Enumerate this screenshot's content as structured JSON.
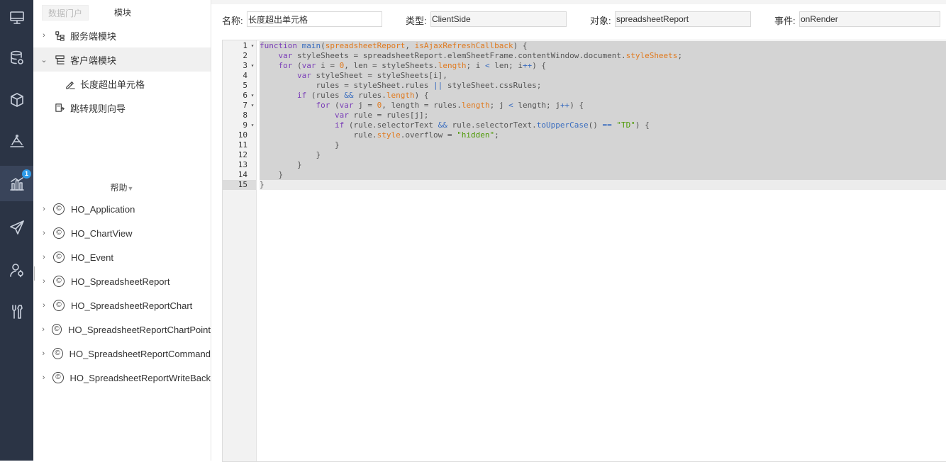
{
  "rail": {
    "items": [
      {
        "name": "monitor-icon"
      },
      {
        "name": "database-icon"
      },
      {
        "name": "cube-icon"
      },
      {
        "name": "layers-icon"
      },
      {
        "name": "chart-icon",
        "active": true,
        "badge": "1"
      },
      {
        "name": "send-icon"
      },
      {
        "name": "user-settings-icon"
      },
      {
        "name": "tools-icon"
      }
    ]
  },
  "panel": {
    "tabs": [
      "数据门户",
      "模块"
    ],
    "tree": [
      {
        "label": "服务端模块",
        "arrow": "›"
      },
      {
        "label": "客户端模块",
        "arrow": "⌄",
        "selected": true
      },
      {
        "label": "长度超出单元格",
        "child": true
      },
      {
        "label": "跳转规则向导"
      }
    ],
    "help_label": "帮助",
    "help_caret": "▼",
    "classes": [
      "HO_Application",
      "HO_ChartView",
      "HO_Event",
      "HO_SpreadsheetReport",
      "HO_SpreadsheetReportChart",
      "HO_SpreadsheetReportChartPoint",
      "HO_SpreadsheetReportCommand",
      "HO_SpreadsheetReportWriteBack"
    ],
    "class_icon": "©"
  },
  "fields": {
    "name_label": "名称:",
    "name_value": "长度超出单元格",
    "type_label": "类型:",
    "type_value": "ClientSide",
    "object_label": "对象:",
    "object_value": "spreadsheetReport",
    "event_label": "事件:",
    "event_value": "onRender"
  },
  "code": {
    "lines": [
      {
        "n": "1",
        "fold": "▾",
        "html": "<span class=\"kw\">function</span> <span class=\"fn\">main</span>(<span class=\"pm\">spreadsheetReport</span>, <span class=\"pm\">isAjaxRefreshCallback</span>) {"
      },
      {
        "n": "2",
        "fold": "",
        "html": "    <span class=\"kw\">var</span> styleSheets = spreadsheetReport.elemSheetFrame.contentWindow.document.<span class=\"pm\">styleSheets</span>;"
      },
      {
        "n": "3",
        "fold": "▾",
        "html": "    <span class=\"kw\">for</span> (<span class=\"kw\">var</span> i = <span class=\"num\">0</span>, len = styleSheets.<span class=\"pm\">length</span>; i <span class=\"op\">&lt;</span> len; i<span class=\"op\">++</span>) {"
      },
      {
        "n": "4",
        "fold": "",
        "html": "        <span class=\"kw\">var</span> styleSheet = styleSheets[i],"
      },
      {
        "n": "5",
        "fold": "",
        "html": "            rules = styleSheet.rules <span class=\"op\">||</span> styleSheet.cssRules;"
      },
      {
        "n": "6",
        "fold": "▾",
        "html": "        <span class=\"kw\">if</span> (rules <span class=\"op\">&amp;&amp;</span> rules.<span class=\"pm\">length</span>) {"
      },
      {
        "n": "7",
        "fold": "▾",
        "html": "            <span class=\"kw\">for</span> (<span class=\"kw\">var</span> j = <span class=\"num\">0</span>, length = rules.<span class=\"pm\">length</span>; j <span class=\"op\">&lt;</span> length; j<span class=\"op\">++</span>) {"
      },
      {
        "n": "8",
        "fold": "",
        "html": "                <span class=\"kw\">var</span> rule = rules[j];"
      },
      {
        "n": "9",
        "fold": "▾",
        "html": "                <span class=\"kw\">if</span> (rule.selectorText <span class=\"op\">&amp;&amp;</span> rule.selectorText.<span class=\"fn\">toUpperCase</span>() <span class=\"op\">==</span> <span class=\"str\">\"TD\"</span>) {"
      },
      {
        "n": "10",
        "fold": "",
        "html": "                    rule.<span class=\"pm\">style</span>.overflow = <span class=\"str\">\"hidden\"</span>;"
      },
      {
        "n": "11",
        "fold": "",
        "html": "                }"
      },
      {
        "n": "12",
        "fold": "",
        "html": "            }"
      },
      {
        "n": "13",
        "fold": "",
        "html": "        }"
      },
      {
        "n": "14",
        "fold": "",
        "html": "    }"
      },
      {
        "n": "15",
        "fold": "",
        "html": "}",
        "cursor": true
      }
    ]
  }
}
